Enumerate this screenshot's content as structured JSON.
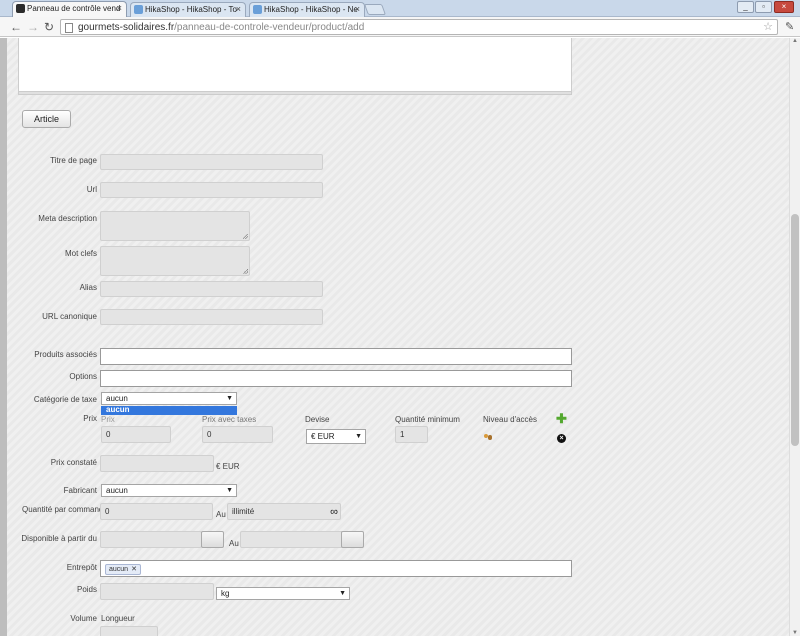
{
  "browser": {
    "tabs": [
      {
        "title": "Panneau de contrôle vend",
        "active": true
      },
      {
        "title": "HikaShop - HikaShop - To",
        "active": false
      },
      {
        "title": "HikaShop - HikaShop - Ne",
        "active": false
      }
    ],
    "url_domain": "gourmets-solidaires.fr",
    "url_path": "/panneau-de-controle-vendeur/product/add"
  },
  "form": {
    "article_button": "Article",
    "labels": {
      "page_title": "Titre de page",
      "url": "Url",
      "meta_description": "Meta description",
      "keywords": "Mot clefs",
      "alias": "Alias",
      "canonical_url": "URL canonique",
      "related_products": "Produits associés",
      "options": "Options",
      "tax_category": "Catégorie de taxe",
      "price": "Prix",
      "noted_price": "Prix constaté",
      "manufacturer": "Fabricant",
      "quantity_per_order": "Quantité par commande",
      "available_from": "Disponible à partir du",
      "warehouse": "Entrepôt",
      "weight": "Poids",
      "volume": "Volume"
    },
    "tax_category": {
      "selected": "aucun",
      "open_option": "aucun"
    },
    "price_table": {
      "headers": {
        "price": "Prix",
        "price_with_tax": "Prix avec taxes",
        "currency": "Devise",
        "min_qty": "Quantité minimum",
        "access": "Niveau d'accès"
      },
      "price_value": "0",
      "price_with_tax_value": "0",
      "currency_selected": "€ EUR",
      "min_qty_value": "1"
    },
    "noted_price_unit": "€ EUR",
    "manufacturer_selected": "aucun",
    "quantity": {
      "from_value": "0",
      "separator": "Au",
      "to_value": "illimité",
      "infinity_symbol": "∞"
    },
    "availability_separator": "Au",
    "warehouse_tag": "aucun",
    "weight_unit": "kg",
    "volume_sublabel": "Longueur"
  }
}
